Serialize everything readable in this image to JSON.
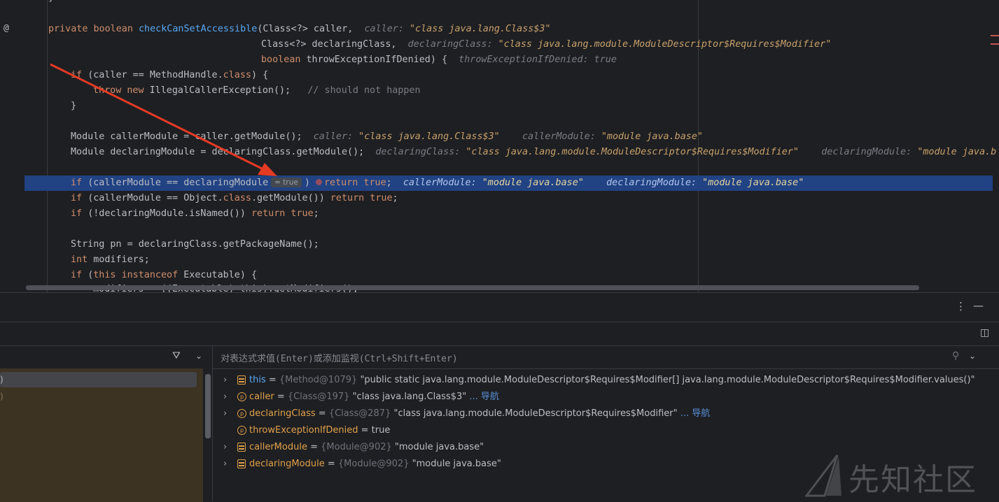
{
  "editor": {
    "gutter_marker": "@",
    "lines": {
      "l0": {
        "kw1": "private",
        "kw2": "boolean",
        "fn": "checkCanSetAccessible",
        "rest": "(Class<?> caller,",
        "hint": "caller:",
        "hval": "\"class java.lang.Class$3\""
      },
      "l1": {
        "code": "Class<?> declaringClass,",
        "hint": "declaringClass:",
        "hval": "\"class java.lang.module.ModuleDescriptor$Requires$Modifier\""
      },
      "l2": {
        "kw": "boolean",
        "code": "throwExceptionIfDenied) {",
        "hint": "throwExceptionIfDenied:",
        "hval": "true"
      },
      "l3": {
        "kw": "if",
        "code": "(caller == MethodHandle.",
        "kw2": "class",
        "tail": ") {"
      },
      "l4": {
        "kw": "throw",
        "kw2": "new",
        "code": "IllegalCallerException();",
        "comment": "// should not happen"
      },
      "l5": {
        "code": "}"
      },
      "l6": {
        "code": "Module callerModule = caller.getModule();",
        "hint1": "caller:",
        "hval1": "\"class java.lang.Class$3\"",
        "hint2": "callerModule:",
        "hval2": "\"module java.base\""
      },
      "l7": {
        "code": "Module declaringModule = declaringClass.getModule();",
        "hint1": "declaringClass:",
        "hval1": "\"class java.lang.module.ModuleDescriptor$Requires$Modifier\"",
        "hint2": "declaringModule:",
        "hval2": "\"module java.b"
      },
      "l8": {
        "kw": "if",
        "code": "(callerModule == declaringModule",
        "inlay": "= true",
        "close": ")",
        "kw2": "return",
        "kw3": "true",
        "semi": ";",
        "hint1": "callerModule:",
        "hval1": "\"module java.base\"",
        "hint2": "declaringModule:",
        "hval2": "\"module java.base\""
      },
      "l9": {
        "kw": "if",
        "code": "(callerModule == Object.",
        "kw2": "class",
        "code2": ".getModule())",
        "kw3": "return",
        "kw4": "true",
        "semi": ";"
      },
      "l10": {
        "kw": "if",
        "code": "(!declaringModule.isNamed())",
        "kw2": "return",
        "kw3": "true",
        "semi": ";"
      },
      "l11": {
        "code": "String pn = declaringClass.getPackageName();"
      },
      "l12": {
        "kw": "int",
        "code": "modifiers;"
      },
      "l13": {
        "kw": "if",
        "code": "(",
        "kw2": "this",
        "kw3": "instanceof",
        "code2": "Executable) {"
      },
      "l14": {
        "code": "modifiers = ((Executable) this).getModifiers();"
      }
    }
  },
  "debugger": {
    "eval_placeholder": "对表达式求值(Enter)或添加监视(Ctrl+Shift+Enter)",
    "variables": [
      {
        "name": "this",
        "ref": "{Method@1079}",
        "value": "\"public static java.lang.module.ModuleDescriptor$Requires$Modifier[] java.lang.module.ModuleDescriptor$Requires$Modifier.values()\"",
        "link": "",
        "icon": "field-icon",
        "expandable": true
      },
      {
        "name": "caller",
        "ref": "{Class@197}",
        "value": "\"class java.lang.Class$3\"",
        "link": "... 导航",
        "icon": "parameter-icon",
        "expandable": true
      },
      {
        "name": "declaringClass",
        "ref": "{Class@287}",
        "value": "\"class java.lang.module.ModuleDescriptor$Requires$Modifier\"",
        "link": "... 导航",
        "icon": "parameter-icon",
        "expandable": true
      },
      {
        "name": "throwExceptionIfDenied",
        "ref": "",
        "value": "true",
        "link": "",
        "icon": "parameter-icon",
        "expandable": false
      },
      {
        "name": "callerModule",
        "ref": "{Module@902}",
        "value": "\"module java.base\"",
        "link": "",
        "icon": "field-icon",
        "expandable": true
      },
      {
        "name": "declaringModule",
        "ref": "{Module@902}",
        "value": "\"module java.base\"",
        "link": "",
        "icon": "field-icon",
        "expandable": true
      }
    ],
    "frames": [
      ")",
      ")"
    ]
  },
  "watermark": {
    "text": "先知社区"
  },
  "colors": {
    "highlight": "#214283",
    "arrow": "#e53a24",
    "field": "#e0a14b",
    "keyword": "#cf8e6d",
    "method": "#56a8f5"
  }
}
